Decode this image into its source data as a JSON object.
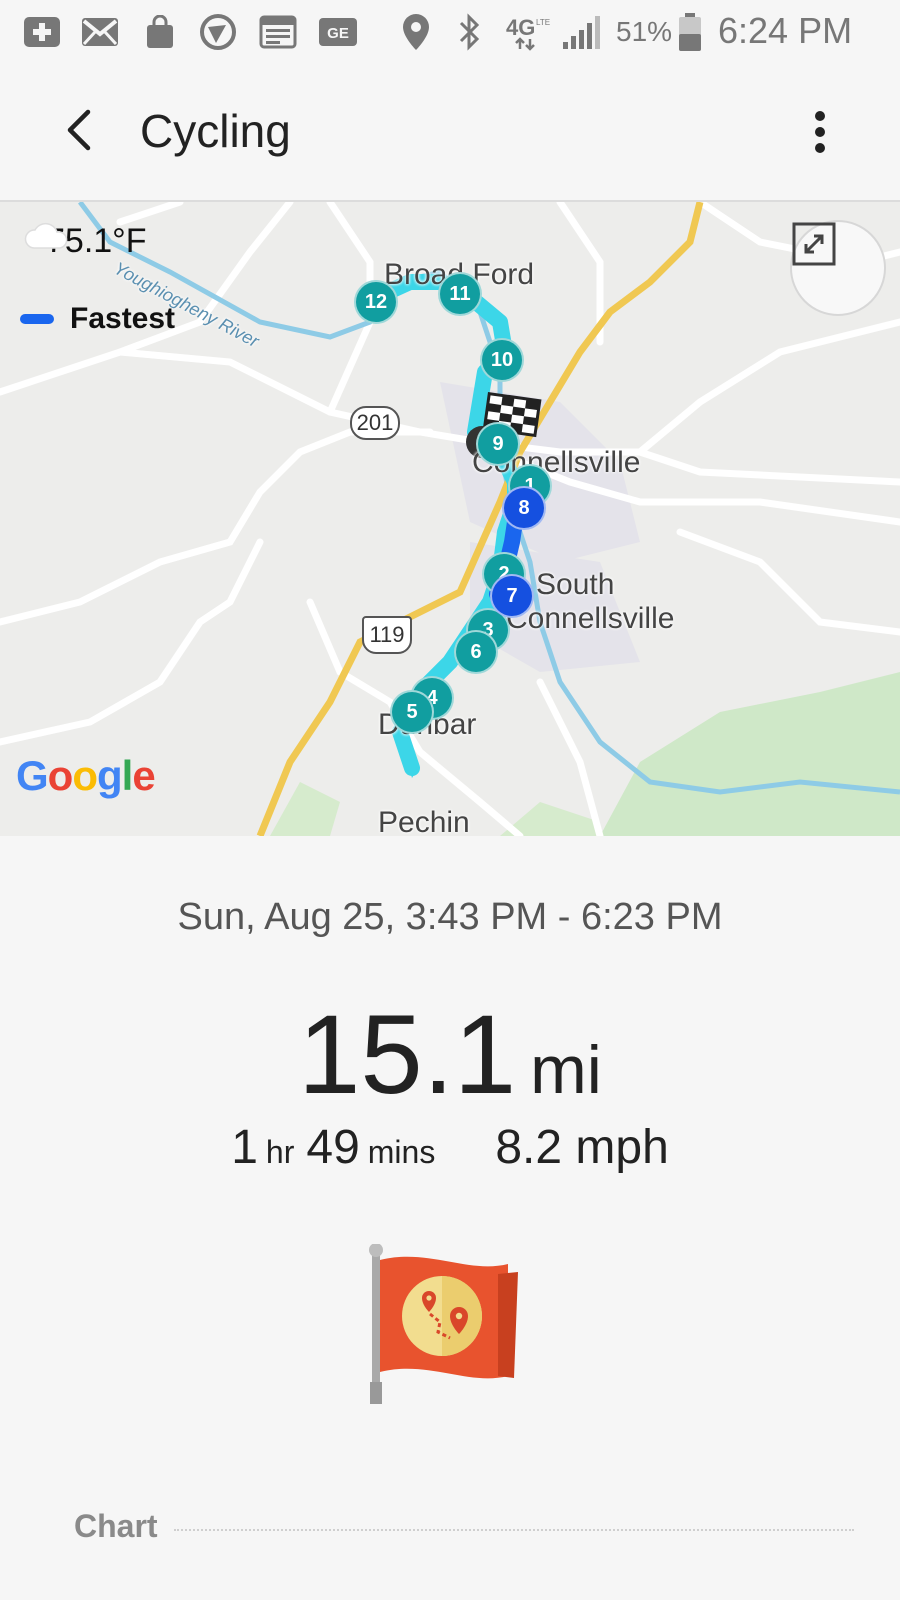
{
  "status_bar": {
    "battery_percent": "51%",
    "time": "6:24 PM",
    "network": "4G",
    "network_sub": "LTE",
    "icons": [
      "add-box-icon",
      "mail-icon",
      "shopping-bag-icon",
      "speed-icon",
      "calendar-icon",
      "gift-card-icon",
      "location-icon",
      "bluetooth-icon",
      "lte-icon",
      "signal-icon",
      "battery-icon"
    ]
  },
  "app_bar": {
    "title": "Cycling",
    "back_icon": "back-arrow-icon",
    "menu_icon": "more-vert-icon"
  },
  "map": {
    "weather": {
      "icon": "cloud-icon",
      "temperature": "75.1°F"
    },
    "legend": {
      "label": "Fastest",
      "color": "#1a66ee"
    },
    "expand_icon": "expand-icon",
    "place_labels": {
      "broad_ford": "Broad Ford",
      "connellsville": "Connellsville",
      "south": "South",
      "south2": "Connellsville",
      "dunbar": "Dunbar",
      "river": "Youghiogheny River",
      "bottom": "Pechin"
    },
    "road_shields": {
      "r201": "201",
      "r119": "119"
    },
    "attribution": "Google",
    "route_markers": [
      "1",
      "2",
      "3",
      "4",
      "5",
      "6",
      "7",
      "8",
      "9",
      "10",
      "11",
      "12"
    ],
    "fastest_markers": [
      "7",
      "8"
    ]
  },
  "summary": {
    "date_range": "Sun, Aug 25, 3:43 PM - 6:23 PM",
    "distance_value": "15.1",
    "distance_unit": "mi",
    "duration_hours": "1",
    "duration_hours_unit": "hr",
    "duration_minutes": "49",
    "duration_minutes_unit": "mins",
    "speed": "8.2 mph",
    "badge_icon": "route-flag-icon"
  },
  "sections": {
    "chart_label": "Chart"
  },
  "colors": {
    "route": "#39d3e6",
    "fastest": "#1a66ee",
    "marker_teal": "#119ea0",
    "marker_blue": "#1550e0",
    "flag": "#e8532e"
  }
}
